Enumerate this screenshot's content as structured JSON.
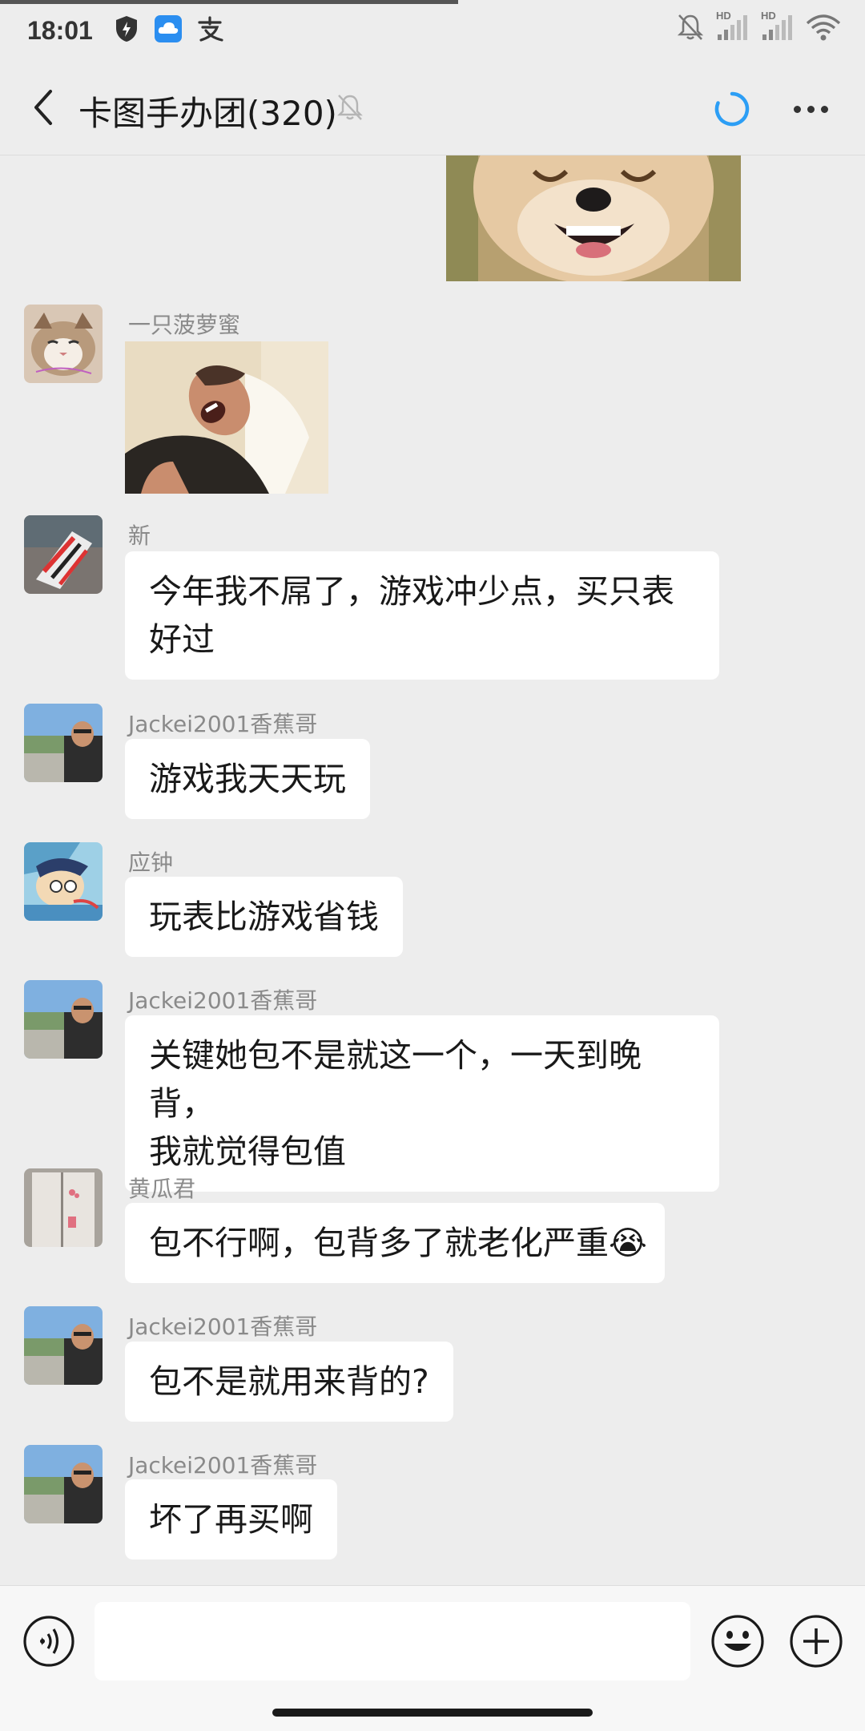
{
  "status_bar": {
    "time": "18:01",
    "left_icons": [
      "shield-icon",
      "cloud-icon",
      "alipay-icon"
    ],
    "right_icons": [
      "mute-bell-icon",
      "signal-hd-icon",
      "signal-hd-icon",
      "wifi-icon"
    ],
    "hd_label": "HD"
  },
  "nav": {
    "title": "卡图手办团(320)",
    "accent_color": "#2c9ef5"
  },
  "messages": [
    {
      "type": "image",
      "sender": "",
      "image_desc": "shiba-dog-photo"
    },
    {
      "type": "image",
      "sender": "一只菠萝蜜",
      "avatar": "cat-avatar",
      "image_desc": "laughing-man-meme"
    },
    {
      "type": "text",
      "sender": "新",
      "avatar": "sneaker-avatar",
      "lines": [
        "今年我不屌了，游戏冲少点，买只表",
        "好过"
      ]
    },
    {
      "type": "text",
      "sender": "Jackei2001香蕉哥",
      "avatar": "man-outdoor-avatar",
      "lines": [
        "游戏我天天玩"
      ]
    },
    {
      "type": "text",
      "sender": "应钟",
      "avatar": "cartoon-avatar",
      "lines": [
        "玩表比游戏省钱"
      ]
    },
    {
      "type": "text",
      "sender": "Jackei2001香蕉哥",
      "avatar": "man-outdoor-avatar",
      "lines": [
        "关键她包不是就这一个，一天到晚背，",
        "我就觉得包值"
      ]
    },
    {
      "type": "text",
      "sender": "黄瓜君",
      "avatar": "door-avatar",
      "lines": [
        "包不行啊，包背多了就老化严重"
      ],
      "trailing_emoji": "😭"
    },
    {
      "type": "text",
      "sender": "Jackei2001香蕉哥",
      "avatar": "man-outdoor-avatar",
      "lines": [
        "包不是就用来背的?"
      ]
    },
    {
      "type": "text",
      "sender": "Jackei2001香蕉哥",
      "avatar": "man-outdoor-avatar",
      "lines": [
        "坏了再买啊"
      ]
    }
  ],
  "input_bar": {
    "placeholder": "",
    "icons": [
      "voice-icon",
      "emoji-icon",
      "plus-icon"
    ]
  }
}
